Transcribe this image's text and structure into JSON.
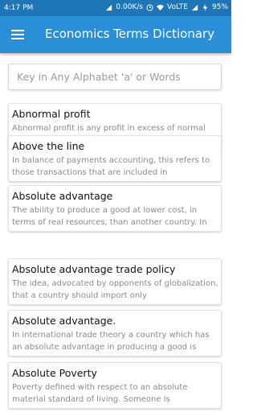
{
  "status_bar": {
    "time": "4:17 PM",
    "net_speed": "0.00K/s",
    "network": "VoLTE",
    "battery": "95%",
    "icons": [
      "signal-icon",
      "clock-icon",
      "wifi-icon",
      "volte-icon",
      "cellular-signal-icon",
      "battery-icon"
    ]
  },
  "app_bar": {
    "title": "Economics Terms Dictionary",
    "menu_icon": "hamburger-menu-icon"
  },
  "search": {
    "placeholder": "Key in Any Alphabet 'a' or Words",
    "value": ""
  },
  "terms": [
    {
      "term": "Abnormal profit",
      "definition": "Abnormal profit is any profit in excess of normal profit - also known as supernormal profit"
    },
    {
      "term": "Above the line",
      "definition": "In balance of payments accounting, this refers to those transactions that are included in"
    },
    {
      "term": "Absolute advantage",
      "definition": "The ability to produce a good at lower cost, in terms of real resources, than another country. In"
    },
    {
      "term": "Absolute advantage trade policy",
      "definition": "The idea, advocated by opponents of globalization, that a country should import only"
    },
    {
      "term": "Absolute advantage.",
      "definition": "In international trade theory a country which has an absolute advantage in producing a good is"
    },
    {
      "term": "Absolute Poverty",
      "definition": "Poverty defined with respect to an absolute material standard of living. Someone is"
    }
  ],
  "colors": {
    "status_bar": "#1e76b9",
    "app_bar": "#2a8fd6",
    "term_text": "#111111",
    "definition_text": "#8a8a8a"
  }
}
